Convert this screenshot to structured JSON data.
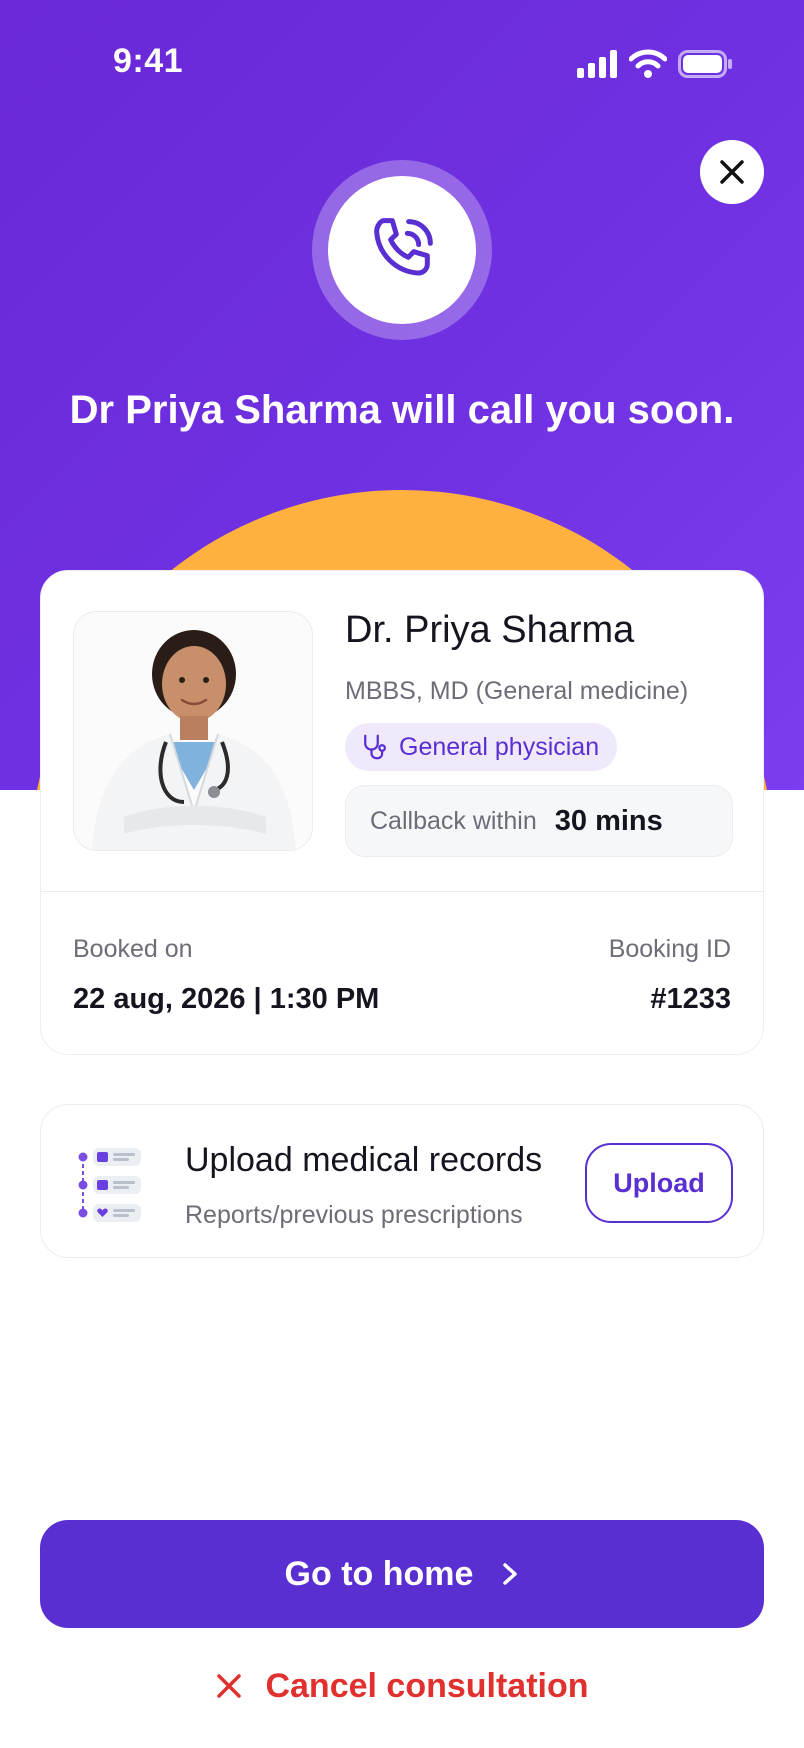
{
  "status_bar": {
    "time": "9:41"
  },
  "headline": "Dr Priya Sharma will call you soon.",
  "doctor": {
    "name": "Dr. Priya Sharma",
    "degree": "MBBS, MD (General medicine)",
    "specialty": "General physician",
    "callback_label": "Callback within",
    "callback_value": "30 mins"
  },
  "booking": {
    "booked_on_label": "Booked on",
    "booked_on_value": "22 aug, 2026 | 1:30 PM",
    "booking_id_label": "Booking ID",
    "booking_id_value": "#1233"
  },
  "upload": {
    "title": "Upload medical records",
    "subtitle": "Reports/previous prescriptions",
    "button_label": "Upload"
  },
  "actions": {
    "home_label": "Go to home",
    "cancel_label": "Cancel consultation"
  },
  "icons": {
    "close": "close-icon",
    "call": "phone-ringing-icon",
    "specialty": "stethoscope-icon",
    "records": "medical-records-icon",
    "home_arrow": "chevron-right-icon",
    "cancel": "x-icon"
  },
  "colors": {
    "primary": "#5a2fd1",
    "hero_gradient_start": "#6a28d6",
    "hero_gradient_end": "#7b3ded",
    "accent_orange": "#ffb13f",
    "danger": "#e0312f"
  }
}
